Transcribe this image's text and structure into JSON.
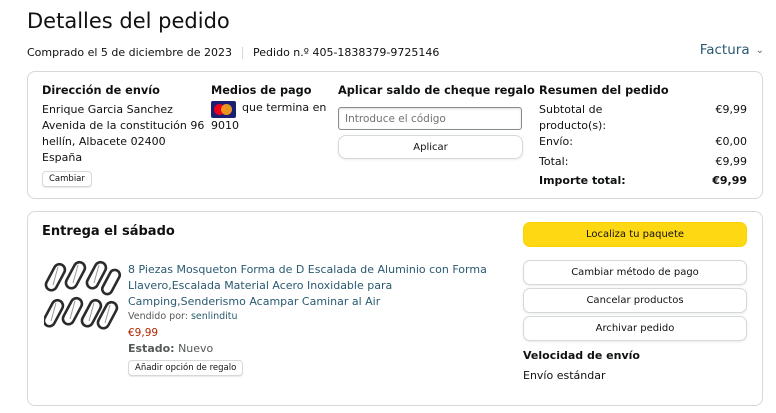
{
  "header": {
    "title": "Detalles del pedido",
    "purchased": "Comprado el 5 de diciembre de 2023",
    "order_number": "Pedido n.º 405-1838379-9725146",
    "invoice_label": "Factura"
  },
  "shipping": {
    "heading": "Dirección de envío",
    "name": "Enrique Garcia Sanchez",
    "line1": "Avenida de la constitución 96",
    "line2": "hellín, Albacete 02400",
    "country": "España",
    "change_label": "Cambiar"
  },
  "payment": {
    "heading": "Medios de pago",
    "card_text": "que termina en",
    "card_last": "9010"
  },
  "gift": {
    "heading": "Aplicar saldo de cheque regalo",
    "placeholder": "Introduce el código",
    "apply_label": "Aplicar"
  },
  "summary": {
    "heading": "Resumen del pedido",
    "rows": [
      {
        "label": "Subtotal de producto(s):",
        "value": "€9,99"
      },
      {
        "label": "Envío:",
        "value": "€0,00"
      },
      {
        "label": "Total:",
        "value": "€9,99"
      },
      {
        "label": "Importe total:",
        "value": "€9,99"
      }
    ]
  },
  "delivery": {
    "title": "Entrega el sábado",
    "product_title": "8 Piezas Mosqueton Forma de D Escalada de Aluminio con Forma Llavero,Escalada Material Acero Inoxidable para Camping,Senderismo Acampar Caminar al Air",
    "sold_by_label": "Vendido por:",
    "seller": "senlinditu",
    "price": "€9,99",
    "status_label": "Estado:",
    "status_value": "Nuevo",
    "gift_option": "Añadir opción de regalo",
    "buttons": {
      "track": "Localiza tu paquete",
      "change_payment": "Cambiar método de pago",
      "cancel": "Cancelar productos",
      "archive": "Archivar pedido"
    },
    "speed_heading": "Velocidad de envío",
    "speed_value": "Envío estándar"
  },
  "colors": {
    "link": "#2a5a70",
    "price": "#b12704",
    "primary_button": "#ffd814",
    "border": "#d5d9d9"
  },
  "icons": [
    "chevron-down-icon",
    "mastercard-icon",
    "carabiner-product-image"
  ]
}
